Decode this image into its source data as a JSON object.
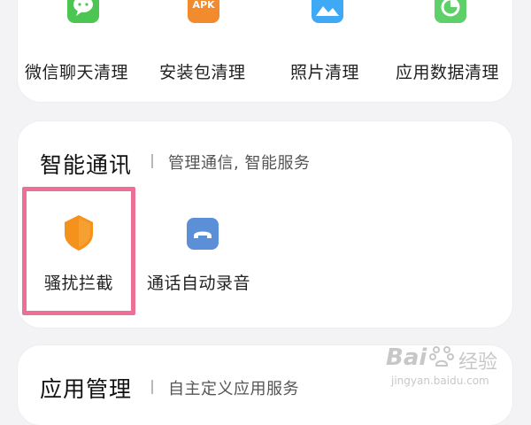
{
  "cleanup": {
    "items": [
      {
        "label": "微信聊天清理",
        "icon": "wechat-icon",
        "color": "#4cc552"
      },
      {
        "label": "安装包清理",
        "icon": "apk-icon",
        "icon_text": "APK",
        "color": "#f28a2e"
      },
      {
        "label": "照片清理",
        "icon": "photo-icon",
        "color": "#3fa9f5"
      },
      {
        "label": "应用数据清理",
        "icon": "pie-chart-icon",
        "color": "#5fcf6a"
      }
    ]
  },
  "smart_comm": {
    "title": "智能通讯",
    "subtitle": "管理通信, 智能服务",
    "items": [
      {
        "label": "骚扰拦截",
        "icon": "shield-icon",
        "color": "#f4921c"
      },
      {
        "label": "通话自动录音",
        "icon": "call-record-icon",
        "color": "#5b8fd8"
      }
    ]
  },
  "app_mgmt": {
    "title": "应用管理",
    "subtitle": "自主定义应用服务"
  },
  "watermark": {
    "brand": "Bai",
    "brand_suffix": "经验",
    "url": "jingyan.baidu.com"
  }
}
